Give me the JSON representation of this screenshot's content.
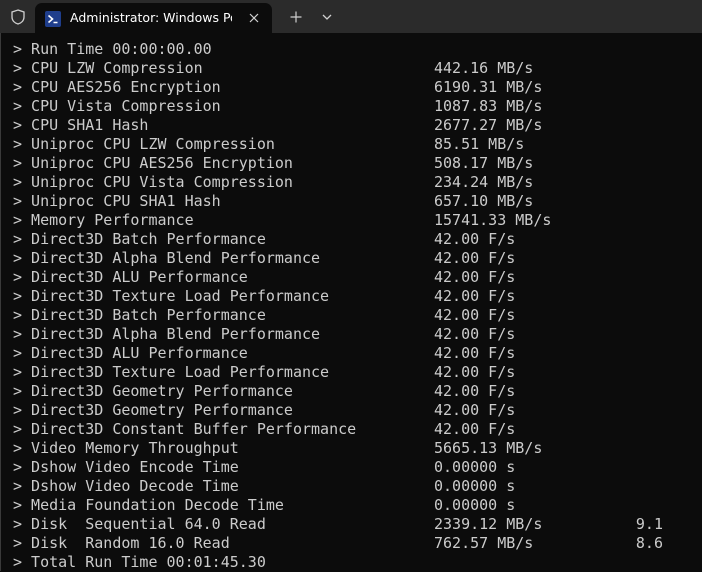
{
  "window": {
    "tab_title": "Administrator: Windows PowerShell"
  },
  "icons": {
    "shield": "shield-icon",
    "tab": "powershell-icon",
    "close": "close-icon",
    "new_tab": "plus-icon",
    "dropdown": "chevron-down-icon"
  },
  "colors": {
    "terminal_bg": "#0c0c0c",
    "text": "#cccccc",
    "tabbar_bg": "#2b2b2b",
    "ps_icon_bg": "#1f3e8c"
  },
  "output": [
    {
      "label": "> Run Time 00:00:00.00",
      "value": "",
      "score": ""
    },
    {
      "label": "> CPU LZW Compression",
      "value": "442.16 MB/s",
      "score": ""
    },
    {
      "label": "> CPU AES256 Encryption",
      "value": "6190.31 MB/s",
      "score": ""
    },
    {
      "label": "> CPU Vista Compression",
      "value": "1087.83 MB/s",
      "score": ""
    },
    {
      "label": "> CPU SHA1 Hash",
      "value": "2677.27 MB/s",
      "score": ""
    },
    {
      "label": "> Uniproc CPU LZW Compression",
      "value": "85.51 MB/s",
      "score": ""
    },
    {
      "label": "> Uniproc CPU AES256 Encryption",
      "value": "508.17 MB/s",
      "score": ""
    },
    {
      "label": "> Uniproc CPU Vista Compression",
      "value": "234.24 MB/s",
      "score": ""
    },
    {
      "label": "> Uniproc CPU SHA1 Hash",
      "value": "657.10 MB/s",
      "score": ""
    },
    {
      "label": "> Memory Performance",
      "value": "15741.33 MB/s",
      "score": ""
    },
    {
      "label": "> Direct3D Batch Performance",
      "value": "42.00 F/s",
      "score": ""
    },
    {
      "label": "> Direct3D Alpha Blend Performance",
      "value": "42.00 F/s",
      "score": ""
    },
    {
      "label": "> Direct3D ALU Performance",
      "value": "42.00 F/s",
      "score": ""
    },
    {
      "label": "> Direct3D Texture Load Performance",
      "value": "42.00 F/s",
      "score": ""
    },
    {
      "label": "> Direct3D Batch Performance",
      "value": "42.00 F/s",
      "score": ""
    },
    {
      "label": "> Direct3D Alpha Blend Performance",
      "value": "42.00 F/s",
      "score": ""
    },
    {
      "label": "> Direct3D ALU Performance",
      "value": "42.00 F/s",
      "score": ""
    },
    {
      "label": "> Direct3D Texture Load Performance",
      "value": "42.00 F/s",
      "score": ""
    },
    {
      "label": "> Direct3D Geometry Performance",
      "value": "42.00 F/s",
      "score": ""
    },
    {
      "label": "> Direct3D Geometry Performance",
      "value": "42.00 F/s",
      "score": ""
    },
    {
      "label": "> Direct3D Constant Buffer Performance",
      "value": "42.00 F/s",
      "score": ""
    },
    {
      "label": "> Video Memory Throughput",
      "value": "5665.13 MB/s",
      "score": ""
    },
    {
      "label": "> Dshow Video Encode Time",
      "value": "0.00000 s",
      "score": ""
    },
    {
      "label": "> Dshow Video Decode Time",
      "value": "0.00000 s",
      "score": ""
    },
    {
      "label": "> Media Foundation Decode Time",
      "value": "0.00000 s",
      "score": ""
    },
    {
      "label": "> Disk  Sequential 64.0 Read",
      "value": "2339.12 MB/s",
      "score": "9.1"
    },
    {
      "label": "> Disk  Random 16.0 Read",
      "value": "762.57 MB/s",
      "score": "8.6"
    },
    {
      "label": "> Total Run Time 00:01:45.30",
      "value": "",
      "score": ""
    }
  ]
}
